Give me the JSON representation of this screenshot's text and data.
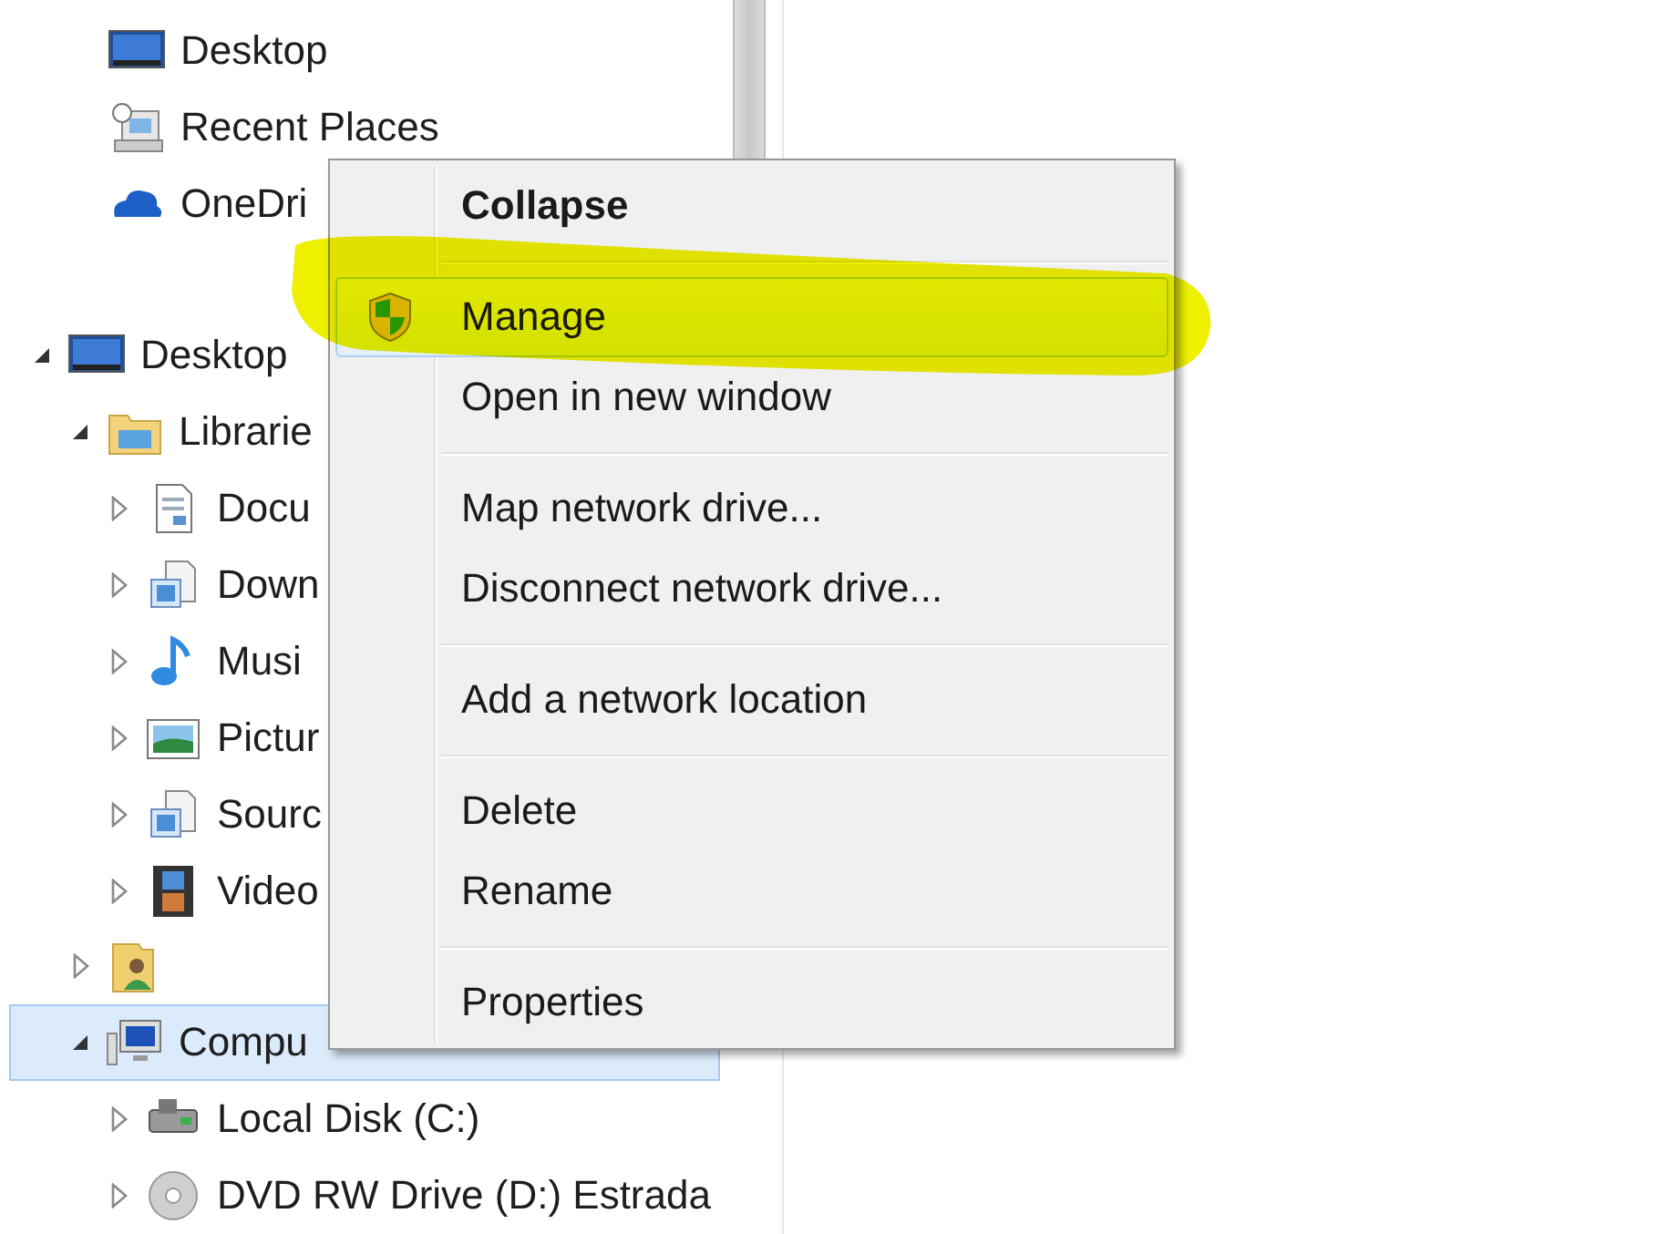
{
  "favorites": [
    {
      "label": "Desktop",
      "kind": "desktop"
    },
    {
      "label": "Recent Places",
      "kind": "recent"
    },
    {
      "label": "OneDri",
      "kind": "cloud"
    }
  ],
  "tree": [
    {
      "label": "Desktop",
      "kind": "desktop",
      "expanded": true,
      "selected": false,
      "children": [
        {
          "label": "Librarie",
          "kind": "library",
          "expanded": true,
          "selected": false,
          "children": [
            {
              "label": "Docu",
              "kind": "document",
              "expanded": false,
              "selected": false
            },
            {
              "label": "Down",
              "kind": "download",
              "expanded": false,
              "selected": false
            },
            {
              "label": "Musi",
              "kind": "music",
              "expanded": false,
              "selected": false
            },
            {
              "label": "Pictur",
              "kind": "pictures",
              "expanded": false,
              "selected": false
            },
            {
              "label": "Sourc",
              "kind": "download",
              "expanded": false,
              "selected": false
            },
            {
              "label": "Video",
              "kind": "video",
              "expanded": false,
              "selected": false
            }
          ]
        },
        {
          "kind": "user",
          "expanded": false,
          "selected": false
        },
        {
          "label": "Compu",
          "kind": "computer",
          "expanded": true,
          "selected": true,
          "children": [
            {
              "label": "Local Disk (C:)",
              "kind": "disk",
              "expanded": false,
              "selected": false
            },
            {
              "label": "DVD RW Drive (D:) Estrada",
              "kind": "dvd",
              "expanded": false,
              "selected": false
            }
          ]
        }
      ]
    }
  ],
  "context_menu": [
    {
      "kind": "default",
      "label": "Collapse",
      "selected": false
    },
    {
      "kind": "separator"
    },
    {
      "kind": "admin",
      "label": "Manage",
      "selected": true
    },
    {
      "kind": "item",
      "label": "Open in new window",
      "selected": false
    },
    {
      "kind": "separator"
    },
    {
      "kind": "item",
      "label": "Map network drive...",
      "selected": false
    },
    {
      "kind": "item",
      "label": "Disconnect network drive...",
      "selected": false
    },
    {
      "kind": "separator"
    },
    {
      "kind": "item",
      "label": "Add a network location",
      "selected": false
    },
    {
      "kind": "separator"
    },
    {
      "kind": "item",
      "label": "Delete",
      "selected": false
    },
    {
      "kind": "item",
      "label": "Rename",
      "selected": false
    },
    {
      "kind": "separator"
    },
    {
      "kind": "item",
      "label": "Properties",
      "selected": false
    }
  ],
  "annotation": {
    "kind": "highlighter"
  }
}
